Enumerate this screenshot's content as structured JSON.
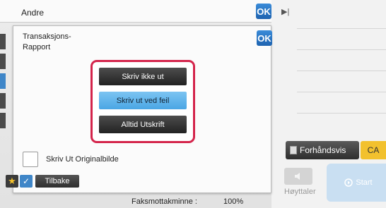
{
  "header": {
    "title": "Andre",
    "ok_label": "OK"
  },
  "dialog": {
    "title": "Transaksjons-\nRapport",
    "ok_label": "OK",
    "options": [
      {
        "label": "Skriv ikke ut",
        "selected": false
      },
      {
        "label": "Skriv ut ved feil",
        "selected": true
      },
      {
        "label": "Alltid Utskrift",
        "selected": false
      }
    ],
    "checkbox": {
      "label": "Skriv Ut Originalbilde",
      "checked": false
    }
  },
  "footer": {
    "back_label": "Tilbake"
  },
  "background": {
    "preview_label": "Forhåndsvis",
    "ca_label": "CA",
    "speaker_label": "Høyttaler",
    "start_label": "Start",
    "fax_memory_label": "Faksmottakminne :",
    "fax_memory_value": "100%"
  },
  "colors": {
    "highlight_border": "#d4244b",
    "selected_option": "#5db3ea",
    "ok_blue": "#2a74c4"
  },
  "icons": [
    "play-icon",
    "star-icon",
    "checkmark-icon",
    "document-icon",
    "speaker-icon",
    "start-icon"
  ]
}
